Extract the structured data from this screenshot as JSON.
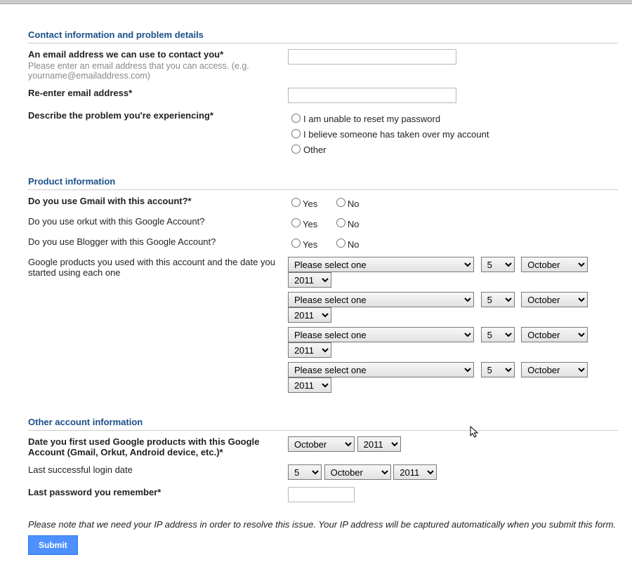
{
  "section1": {
    "title": "Contact information and problem details",
    "email_label": "An email address we can use to contact you*",
    "email_hint": "Please enter an email address that you can access. (e.g. yourname@emailaddress.com)",
    "reenter_label": "Re-enter email address*",
    "describe_label": "Describe the problem you're experiencing*",
    "opt1": "I am unable to reset my password",
    "opt2": "I believe someone has taken over my account",
    "opt3": "Other"
  },
  "section2": {
    "title": "Product information",
    "gmail_label": "Do you use Gmail with this account?*",
    "orkut_label": "Do you use orkut with this Google Account?",
    "blogger_label": "Do you use Blogger with this Google Account?",
    "yes": "Yes",
    "no": "No",
    "products_label": "Google products you used with this account and the date you started using each one",
    "product_select": "Please select one",
    "day": "5",
    "month": "October",
    "year": "2011"
  },
  "section3": {
    "title": "Other account information",
    "first_used_label": "Date you first used Google products with this Google Account (Gmail, Orkut, Android device, etc.)*",
    "first_month": "October",
    "first_year": "2011",
    "last_login_label": "Last successful login date",
    "last_day": "5",
    "last_month": "October",
    "last_year": "2011",
    "last_password_label": "Last password you remember*"
  },
  "footer": {
    "note": "Please note that we need your IP address in order to resolve this issue. Your IP address will be captured automatically when you submit this form.",
    "submit": "Submit"
  }
}
